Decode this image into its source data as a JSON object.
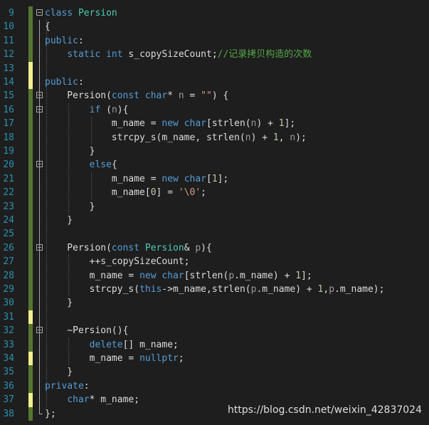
{
  "editor": {
    "lines": [
      {
        "n": "9",
        "change": "saved",
        "fold": true,
        "tokens": [
          [
            "kw",
            "class"
          ],
          [
            "text",
            " "
          ],
          [
            "type",
            "Persion"
          ]
        ]
      },
      {
        "n": "10",
        "change": "saved",
        "fold": false,
        "tokens": [
          [
            "text",
            "{"
          ]
        ]
      },
      {
        "n": "11",
        "change": "saved",
        "fold": false,
        "tokens": [
          [
            "kw",
            "public"
          ],
          [
            "text",
            ":"
          ]
        ]
      },
      {
        "n": "12",
        "change": "saved",
        "fold": false,
        "tokens": [
          [
            "text",
            "    "
          ],
          [
            "kw",
            "static"
          ],
          [
            "text",
            " "
          ],
          [
            "kw",
            "int"
          ],
          [
            "text",
            " s_copySizeCount;"
          ],
          [
            "cmt",
            "//记录拷贝构造的次数"
          ]
        ]
      },
      {
        "n": "13",
        "change": "unsaved",
        "fold": false,
        "tokens": []
      },
      {
        "n": "14",
        "change": "unsaved",
        "fold": false,
        "tokens": [
          [
            "kw",
            "public"
          ],
          [
            "text",
            ":"
          ]
        ]
      },
      {
        "n": "15",
        "change": "saved",
        "fold": true,
        "tokens": [
          [
            "text",
            "    Persion("
          ],
          [
            "kw",
            "const"
          ],
          [
            "text",
            " "
          ],
          [
            "kw",
            "char"
          ],
          [
            "text",
            "* "
          ],
          [
            "param",
            "n"
          ],
          [
            "text",
            " = "
          ],
          [
            "str",
            "\"\""
          ],
          [
            "text",
            ") {"
          ]
        ]
      },
      {
        "n": "16",
        "change": "saved",
        "fold": true,
        "tokens": [
          [
            "text",
            "        "
          ],
          [
            "kw",
            "if"
          ],
          [
            "text",
            " ("
          ],
          [
            "param",
            "n"
          ],
          [
            "text",
            "){"
          ]
        ]
      },
      {
        "n": "17",
        "change": "saved",
        "fold": false,
        "tokens": [
          [
            "text",
            "            m_name = "
          ],
          [
            "kw",
            "new"
          ],
          [
            "text",
            " "
          ],
          [
            "kw",
            "char"
          ],
          [
            "text",
            "[strlen("
          ],
          [
            "param",
            "n"
          ],
          [
            "text",
            ") + "
          ],
          [
            "num",
            "1"
          ],
          [
            "text",
            "];"
          ]
        ]
      },
      {
        "n": "18",
        "change": "saved",
        "fold": false,
        "tokens": [
          [
            "text",
            "            strcpy_s(m_name, strlen("
          ],
          [
            "param",
            "n"
          ],
          [
            "text",
            ") + "
          ],
          [
            "num",
            "1"
          ],
          [
            "text",
            ", "
          ],
          [
            "param",
            "n"
          ],
          [
            "text",
            ");"
          ]
        ]
      },
      {
        "n": "19",
        "change": "saved",
        "fold": false,
        "tokens": [
          [
            "text",
            "        }"
          ]
        ]
      },
      {
        "n": "20",
        "change": "saved",
        "fold": true,
        "tokens": [
          [
            "text",
            "        "
          ],
          [
            "kw",
            "else"
          ],
          [
            "text",
            "{"
          ]
        ]
      },
      {
        "n": "21",
        "change": "saved",
        "fold": false,
        "tokens": [
          [
            "text",
            "            m_name = "
          ],
          [
            "kw",
            "new"
          ],
          [
            "text",
            " "
          ],
          [
            "kw",
            "char"
          ],
          [
            "text",
            "["
          ],
          [
            "num",
            "1"
          ],
          [
            "text",
            "];"
          ]
        ]
      },
      {
        "n": "22",
        "change": "saved",
        "fold": false,
        "tokens": [
          [
            "text",
            "            m_name["
          ],
          [
            "num",
            "0"
          ],
          [
            "text",
            "] = "
          ],
          [
            "str",
            "'\\0'"
          ],
          [
            "text",
            ";"
          ]
        ]
      },
      {
        "n": "23",
        "change": "saved",
        "fold": false,
        "tokens": [
          [
            "text",
            "        }"
          ]
        ]
      },
      {
        "n": "24",
        "change": "saved",
        "fold": false,
        "tokens": [
          [
            "text",
            "    }"
          ]
        ]
      },
      {
        "n": "25",
        "change": "saved",
        "fold": false,
        "tokens": []
      },
      {
        "n": "26",
        "change": "saved",
        "fold": true,
        "tokens": [
          [
            "text",
            "    Persion("
          ],
          [
            "kw",
            "const"
          ],
          [
            "text",
            " "
          ],
          [
            "type",
            "Persion"
          ],
          [
            "text",
            "& "
          ],
          [
            "param",
            "p"
          ],
          [
            "text",
            "){"
          ]
        ]
      },
      {
        "n": "27",
        "change": "saved",
        "fold": false,
        "tokens": [
          [
            "text",
            "        ++s_copySizeCount;"
          ]
        ]
      },
      {
        "n": "28",
        "change": "saved",
        "fold": false,
        "tokens": [
          [
            "text",
            "        m_name = "
          ],
          [
            "kw",
            "new"
          ],
          [
            "text",
            " "
          ],
          [
            "kw",
            "char"
          ],
          [
            "text",
            "[strlen("
          ],
          [
            "param",
            "p"
          ],
          [
            "text",
            ".m_name) + "
          ],
          [
            "num",
            "1"
          ],
          [
            "text",
            "];"
          ]
        ]
      },
      {
        "n": "29",
        "change": "saved",
        "fold": false,
        "tokens": [
          [
            "text",
            "        strcpy_s("
          ],
          [
            "kw",
            "this"
          ],
          [
            "text",
            "->m_name,strlen("
          ],
          [
            "param",
            "p"
          ],
          [
            "text",
            ".m_name) + "
          ],
          [
            "num",
            "1"
          ],
          [
            "text",
            ","
          ],
          [
            "param",
            "p"
          ],
          [
            "text",
            ".m_name);"
          ]
        ]
      },
      {
        "n": "30",
        "change": "saved",
        "fold": false,
        "tokens": [
          [
            "text",
            "    }"
          ]
        ]
      },
      {
        "n": "31",
        "change": "unsaved",
        "fold": false,
        "tokens": []
      },
      {
        "n": "32",
        "change": "saved",
        "fold": true,
        "tokens": [
          [
            "text",
            "    ~Persion(){"
          ]
        ]
      },
      {
        "n": "33",
        "change": "saved",
        "fold": false,
        "tokens": [
          [
            "text",
            "        "
          ],
          [
            "kw",
            "delete"
          ],
          [
            "text",
            "[] m_name;"
          ]
        ]
      },
      {
        "n": "34",
        "change": "unsaved",
        "fold": false,
        "tokens": [
          [
            "text",
            "        m_name = "
          ],
          [
            "kw",
            "nullptr"
          ],
          [
            "text",
            ";"
          ]
        ]
      },
      {
        "n": "35",
        "change": "saved",
        "fold": false,
        "tokens": [
          [
            "text",
            "    }"
          ]
        ]
      },
      {
        "n": "36",
        "change": "saved",
        "fold": false,
        "tokens": [
          [
            "kw",
            "private"
          ],
          [
            "text",
            ":"
          ]
        ]
      },
      {
        "n": "37",
        "change": "unsaved",
        "fold": false,
        "tokens": [
          [
            "text",
            "    "
          ],
          [
            "kw",
            "char"
          ],
          [
            "text",
            "* m_name;"
          ]
        ]
      },
      {
        "n": "38",
        "change": "saved",
        "fold": false,
        "tokens": [
          [
            "text",
            "};"
          ]
        ]
      }
    ]
  },
  "watermark": "https://blog.csdn.net/weixin_42837024",
  "colors": {
    "background": "#1e1e1e",
    "keyword": "#569cd6",
    "type": "#4ec9b0",
    "comment": "#57a64a",
    "string": "#d69d85",
    "number": "#b5cea8",
    "parameter": "#9a9a9a",
    "line_number": "#2b91af",
    "change_saved": "#577430",
    "change_unsaved": "#efef8e"
  },
  "icons": {
    "fold": "collapse-minus-icon"
  }
}
